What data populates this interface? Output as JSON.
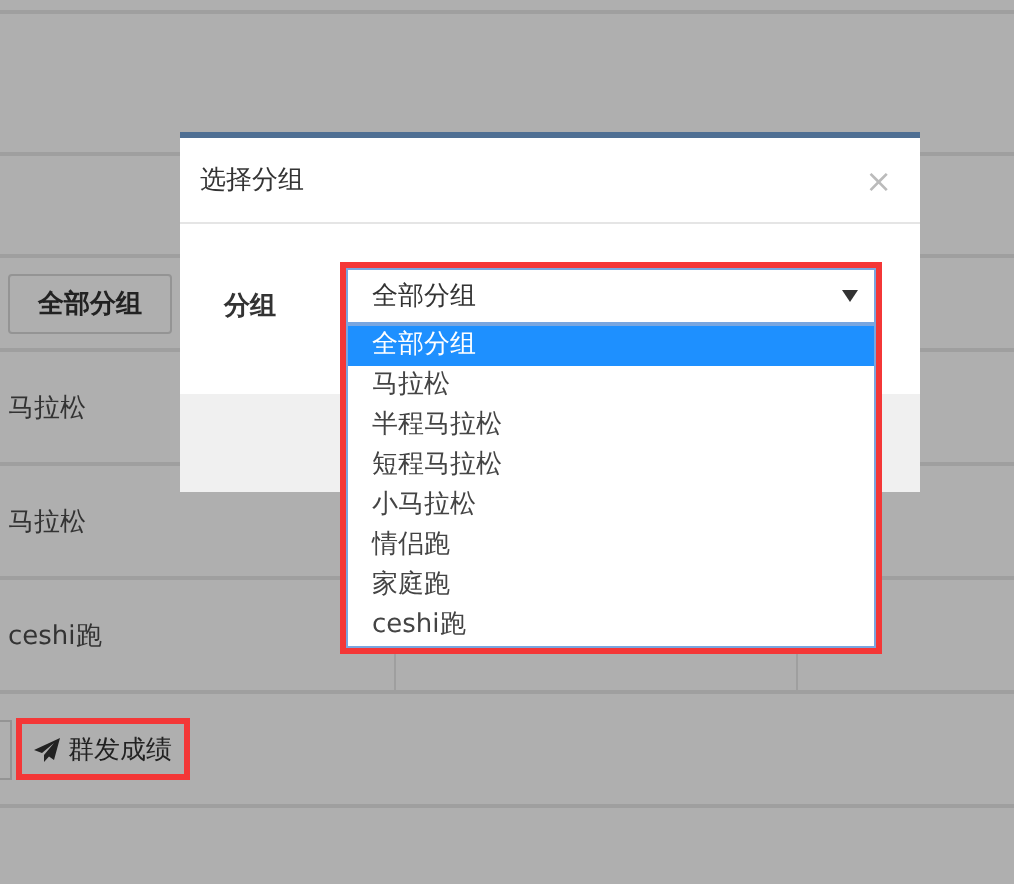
{
  "background": {
    "filter_button": "全部分组",
    "rows": [
      {
        "name": "马拉松"
      },
      {
        "name": "马拉松"
      },
      {
        "name": "ceshi跑"
      }
    ],
    "send_button": {
      "label": "群发成绩",
      "highlighted": true
    }
  },
  "dialog": {
    "title": "选择分组",
    "close": "×",
    "field_label": "分组",
    "select": {
      "value": "全部分组",
      "highlighted": true,
      "options": [
        {
          "label": "全部分组",
          "selected": true
        },
        {
          "label": "马拉松",
          "selected": false
        },
        {
          "label": "半程马拉松",
          "selected": false
        },
        {
          "label": "短程马拉松",
          "selected": false
        },
        {
          "label": "小马拉松",
          "selected": false
        },
        {
          "label": "情侣跑",
          "selected": false
        },
        {
          "label": "家庭跑",
          "selected": false
        },
        {
          "label": "ceshi跑",
          "selected": false
        }
      ]
    }
  }
}
